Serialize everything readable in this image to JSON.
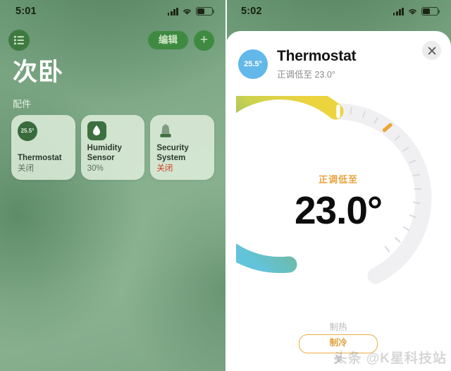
{
  "accent_colors": {
    "panel_green": "#84ad8c",
    "dark_green": "#3e8a41",
    "card_bg": "#e3f0df",
    "orange": "#e8a33c",
    "alert_red": "#d63b22",
    "cool_blue": "#62b8e8",
    "warm_yellow": "#ead84a"
  },
  "left_panel": {
    "status_bar": {
      "time": "5:01",
      "signal_icon": "signal-bars-icon",
      "wifi_icon": "wifi-icon",
      "battery_icon": "battery-icon"
    },
    "nav": {
      "list_icon": "list-bullet-icon",
      "edit_label": "编辑",
      "add_label": "+"
    },
    "room_title": "次卧",
    "section_label": "配件",
    "accessories": [
      {
        "icon": "thermostat-icon",
        "badge_value": "25.5°",
        "name": "Thermostat",
        "status": "关闭",
        "status_alert": false
      },
      {
        "icon": "water-drop-icon",
        "badge_value": "",
        "name": "Humidity Sensor",
        "status": "30%",
        "status_alert": false
      },
      {
        "icon": "siren-icon",
        "badge_value": "",
        "name": "Security System",
        "status": "关闭",
        "status_alert": true
      }
    ]
  },
  "right_panel": {
    "status_bar": {
      "time": "5:02",
      "signal_icon": "signal-bars-icon",
      "wifi_icon": "wifi-icon",
      "battery_icon": "battery-icon"
    },
    "sheet": {
      "current_temp_badge": "25.5°",
      "title": "Thermostat",
      "subtitle": "正调低至 23.0°",
      "close_icon": "close-icon"
    },
    "dial": {
      "state_label": "正调低至",
      "target_value": "23.0°",
      "current_temp": 25.5,
      "target_temp": 23.0,
      "handle_icon": "dial-handle-icon",
      "current_temp_tick_icon": "current-temp-tick-icon"
    },
    "modes": [
      {
        "label": "制热",
        "selected": false
      },
      {
        "label": "制冷",
        "selected": true
      },
      {
        "label": "关",
        "selected": false
      }
    ]
  },
  "watermark": "头条 @K星科技站"
}
